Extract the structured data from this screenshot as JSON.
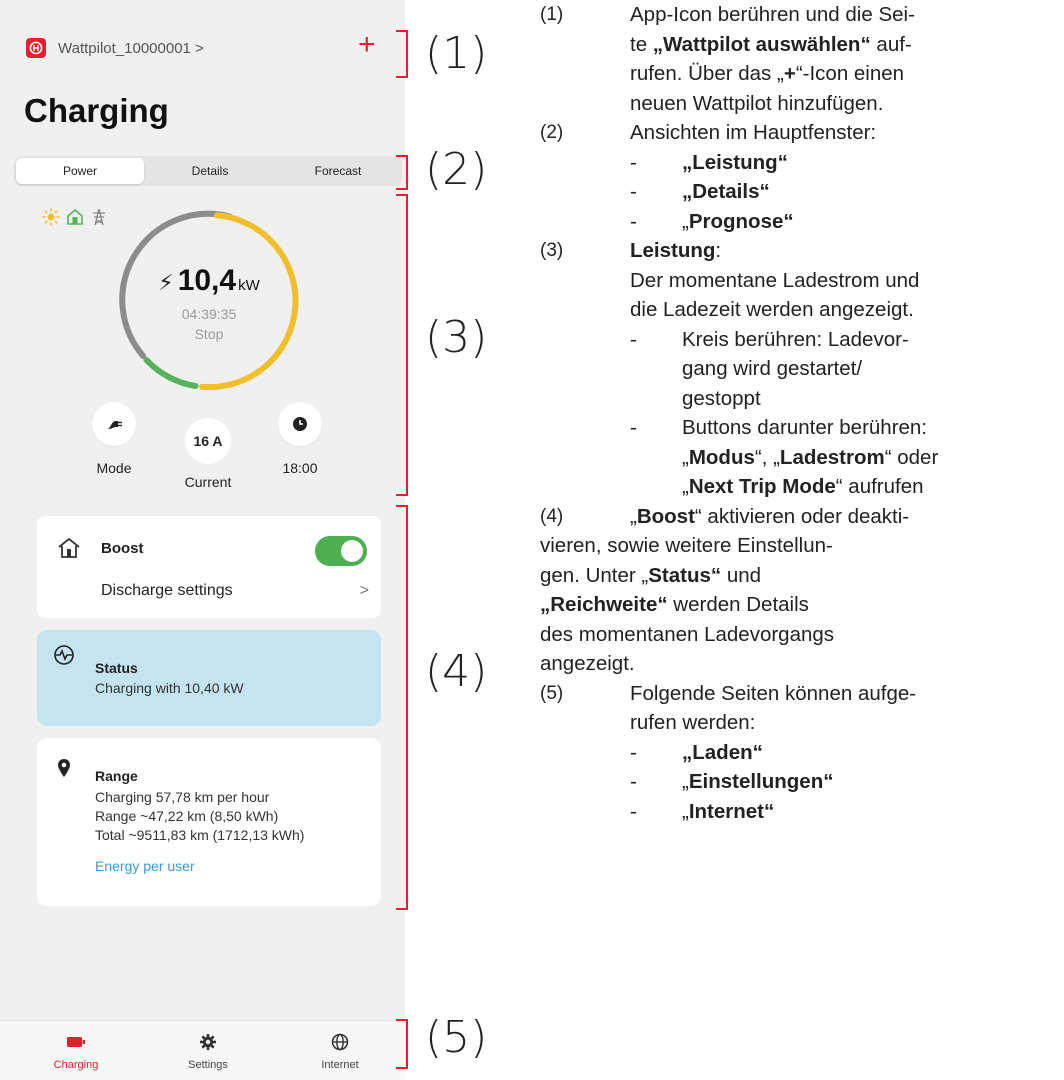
{
  "app": {
    "device_name": "Wattpilot_10000001 >",
    "plus": "+",
    "title": "Charging"
  },
  "tabs": [
    {
      "label": "Power",
      "active": true
    },
    {
      "label": "Details",
      "active": false
    },
    {
      "label": "Forecast",
      "active": false
    }
  ],
  "power": {
    "value": "10,4",
    "unit": "kW",
    "time": "04:39:35",
    "action": "Stop",
    "controls": {
      "mode_label": "Mode",
      "current_value": "16 A",
      "current_label": "Current",
      "time_label": "18:00"
    },
    "source_icons": [
      "sun-icon",
      "home-icon",
      "grid-pylon-icon"
    ]
  },
  "boost_card": {
    "title": "Boost",
    "toggle_on": true,
    "discharge_label": "Discharge settings",
    "chevron": ">"
  },
  "status_card": {
    "title": "Status",
    "text": "Charging with 10,40 kW"
  },
  "range_card": {
    "title": "Range",
    "line1": "Charging 57,78 km per hour",
    "line2": "Range ~47,22 km (8,50 kWh)",
    "line3": "Total ~9511,83 km (1712,13 kWh)",
    "link": "Energy per user"
  },
  "nav": [
    {
      "label": "Charging",
      "icon": "battery-icon",
      "active": true
    },
    {
      "label": "Settings",
      "icon": "gear-icon",
      "active": false
    },
    {
      "label": "Internet",
      "icon": "globe-icon",
      "active": false
    }
  ],
  "annotations": {
    "markers": [
      "(1)",
      "(2)",
      "(3)",
      "(4)",
      "(5)"
    ],
    "items": {
      "n1": "(1)",
      "t1_a": "App-Icon berühren und die Sei-",
      "t1_b": "te ",
      "t1_b_bold": "„Wattpilot auswählen“",
      "t1_b_rest": " auf-",
      "t1_c": "rufen. Über das „",
      "t1_c_bold": "+",
      "t1_c_rest": "“-Icon einen",
      "t1_d": "neuen Wattpilot hinzufügen.",
      "n2": "(2)",
      "t2": "Ansichten im Hauptfenster:",
      "t2_li1": "„Leistung“",
      "t2_li2": "„Details“",
      "t2_li3_pre": "„",
      "t2_li3": "Prognose“",
      "n3": "(3)",
      "t3_bold": "Leistung",
      "t3_colon": ":",
      "t3_a": "Der momentane Ladestrom und",
      "t3_b": "die Ladezeit werden angezeigt.",
      "t3_li1_a": "Kreis berühren: Ladevor-",
      "t3_li1_b": "gang wird gestartet/",
      "t3_li1_c": "gestoppt",
      "t3_li2_a": "Buttons darunter berühren:",
      "t3_li2_b1": "„",
      "t3_li2_b2": "Modus",
      "t3_li2_b3": "“, „",
      "t3_li2_b4": "Ladestrom",
      "t3_li2_b5": "“ oder",
      "t3_li2_c1": "„",
      "t3_li2_c2": "Next Trip Mode",
      "t3_li2_c3": "“ aufrufen",
      "n4": "(4)",
      "t4_a1": "„",
      "t4_a2": "Boost",
      "t4_a3": "“ aktivieren oder deakti-",
      "t4_b": "vieren, sowie weitere Einstellun-",
      "t4_c1": "gen. Unter „",
      "t4_c2": "Status“",
      "t4_c3": " und",
      "t4_d1": "„",
      "t4_d2": "Reichweite“",
      "t4_d3": " werden Details",
      "t4_e": "des momentanen Ladevorgangs",
      "t4_f": "angezeigt.",
      "n5": "(5)",
      "t5_a": "Folgende Seiten können aufge-",
      "t5_b": "rufen werden:",
      "t5_li1": "„Laden“",
      "t5_li2_pre": "„",
      "t5_li2": "Einstellungen“",
      "t5_li3_pre": "„",
      "t5_li3": "Internet“",
      "dash": "-"
    }
  },
  "colors": {
    "accent_red": "#e3202b",
    "gauge_yellow": "#f0c02c",
    "gauge_gray": "#8c8c8c",
    "gauge_green": "#55b35a",
    "toggle_green": "#4caf50",
    "status_blue": "#c4e4f1",
    "link_blue": "#3a9ad9"
  }
}
